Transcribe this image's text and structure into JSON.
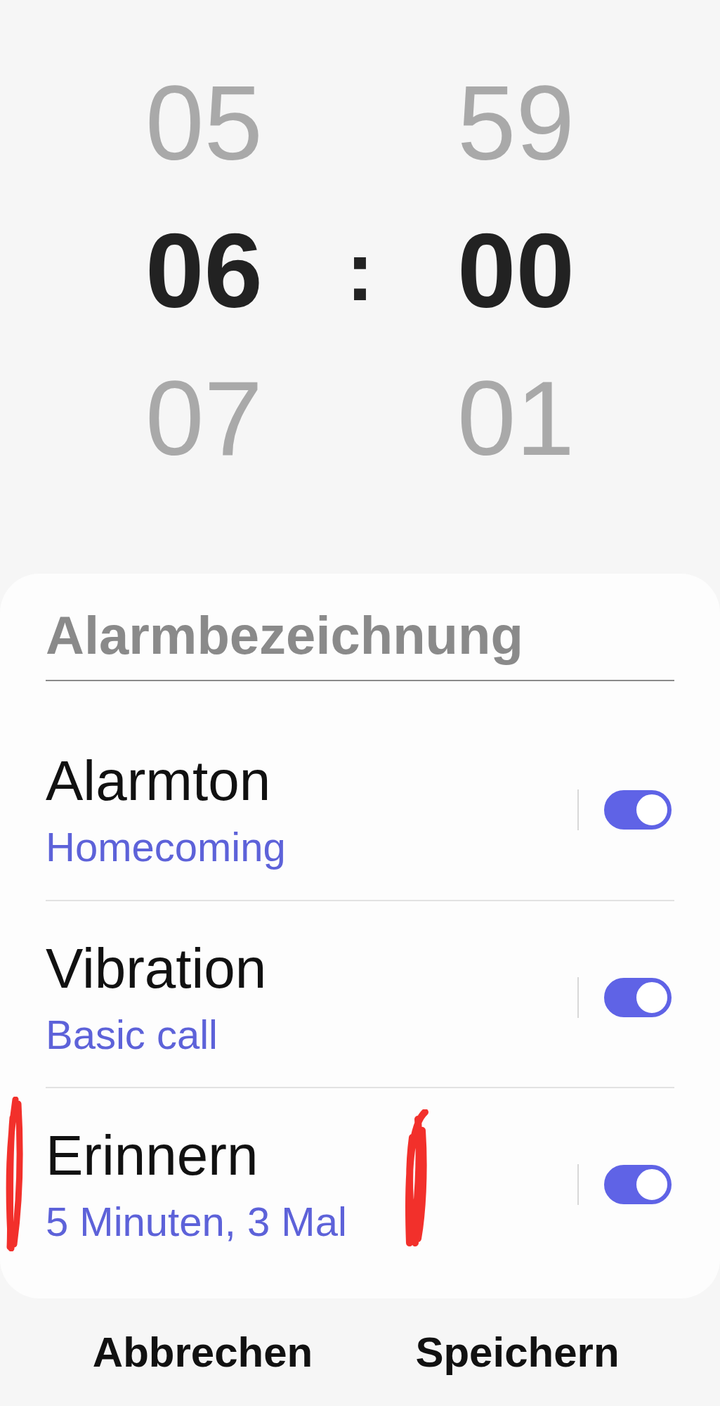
{
  "time_picker": {
    "separator": ":",
    "columns": [
      {
        "values": [
          {
            "text": "05",
            "selected": false
          },
          {
            "text": "06",
            "selected": true
          },
          {
            "text": "07",
            "selected": false
          }
        ]
      },
      {
        "values": [
          {
            "text": "59",
            "selected": false
          },
          {
            "text": "00",
            "selected": true
          },
          {
            "text": "01",
            "selected": false
          }
        ]
      }
    ]
  },
  "alarm_name": {
    "placeholder": "Alarmbezeichnung"
  },
  "settings": [
    {
      "title": "Alarmton",
      "subtitle": "Homecoming",
      "on": true
    },
    {
      "title": "Vibration",
      "subtitle": "Basic call",
      "on": true
    },
    {
      "title": "Erinnern",
      "subtitle": "5 Minuten, 3 Mal",
      "on": true
    }
  ],
  "buttons": [
    "Abbrechen",
    "Speichern"
  ]
}
